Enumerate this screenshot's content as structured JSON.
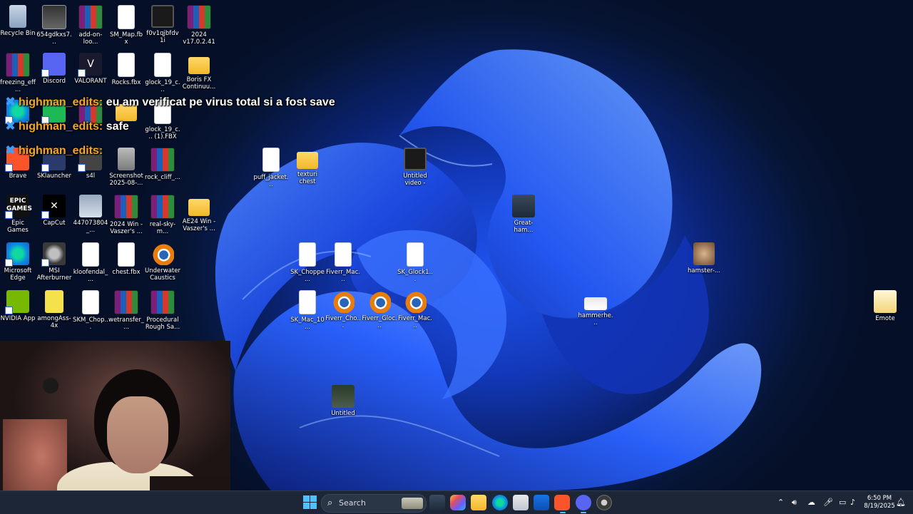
{
  "desktop": {
    "icons": [
      {
        "id": "recycle-bin",
        "label": "Recycle Bin"
      },
      {
        "id": "file-654gdkxs7",
        "label": "654gdkxs7..."
      },
      {
        "id": "add-on-loo",
        "label": "add-on-loo..."
      },
      {
        "id": "sm-map-fbx",
        "label": "SM_Map.fbx"
      },
      {
        "id": "f0v1qjbfdv1i",
        "label": "f0v1qjbfdv1i"
      },
      {
        "id": "2024-v17",
        "label": "2024 v17.0.2.416"
      },
      {
        "id": "freezing-eff",
        "label": "freezing_eff..."
      },
      {
        "id": "discord",
        "label": "Discord"
      },
      {
        "id": "valorant",
        "label": "VALORANT"
      },
      {
        "id": "rocks-fbx",
        "label": "Rocks.fbx"
      },
      {
        "id": "glock-19-c",
        "label": "glock_19_c..."
      },
      {
        "id": "boris-fx",
        "label": "Boris FX Continuu..."
      },
      {
        "id": "glock-19-c-1",
        "label": "glock_19_c... (1).FBX"
      },
      {
        "id": "brave",
        "label": "Brave"
      },
      {
        "id": "sklauncher",
        "label": "SKlauncher"
      },
      {
        "id": "s4l",
        "label": "s4l"
      },
      {
        "id": "screenshot-2025",
        "label": "Screenshot 2025-08-..."
      },
      {
        "id": "rock-cliff",
        "label": "rock_cliff_..."
      },
      {
        "id": "puff-jacket",
        "label": "puff_jacket..."
      },
      {
        "id": "texturi-chest",
        "label": "texturi chest"
      },
      {
        "id": "untitled-video",
        "label": "Untitled video - Ma..."
      },
      {
        "id": "epic-games",
        "label": "Epic Games Launcher"
      },
      {
        "id": "capcut",
        "label": "CapCut"
      },
      {
        "id": "447073804",
        "label": "447073804_..."
      },
      {
        "id": "2024-win-vaszer",
        "label": "2024 Win - Vaszer's ..."
      },
      {
        "id": "real-sky-m",
        "label": "real-sky-m..."
      },
      {
        "id": "ae24-win-vaszer",
        "label": "AE24 Win - Vaszer's ..."
      },
      {
        "id": "great-ham",
        "label": "Great-ham..."
      },
      {
        "id": "microsoft-edge",
        "label": "Microsoft Edge"
      },
      {
        "id": "msi-afterburner",
        "label": "MSI Afterburner"
      },
      {
        "id": "kloofendal",
        "label": "kloofendal_..."
      },
      {
        "id": "chest-fbx",
        "label": "chest.fbx"
      },
      {
        "id": "underwater-caustics",
        "label": "Underwater Caustics Li..."
      },
      {
        "id": "sk-choppe",
        "label": "SK_Choppe..."
      },
      {
        "id": "fiverr-mac-1",
        "label": "Fiverr_Mac..."
      },
      {
        "id": "sk-glock1",
        "label": "SK_Glock1..."
      },
      {
        "id": "hamster",
        "label": "hamster-..."
      },
      {
        "id": "nvidia-app",
        "label": "NVIDIA App"
      },
      {
        "id": "amongass",
        "label": "amongAss-4x"
      },
      {
        "id": "skm-chop",
        "label": "SKM_Chop..."
      },
      {
        "id": "wetransfer",
        "label": "wetransfer_..."
      },
      {
        "id": "procedural-rough",
        "label": "Procedural Rough Sa..."
      },
      {
        "id": "sk-mac-10",
        "label": "SK_Mac_10..."
      },
      {
        "id": "fiverr-cho",
        "label": "Fiverr_Cho..."
      },
      {
        "id": "fiverr-gloc",
        "label": "Fiverr_Gloc..."
      },
      {
        "id": "fiverr-mac-2",
        "label": "Fiverr_Mac..."
      },
      {
        "id": "hammerhe",
        "label": "hammerhe..."
      },
      {
        "id": "emote",
        "label": "Emote"
      },
      {
        "id": "untitled",
        "label": "Untitled"
      }
    ]
  },
  "chat": [
    {
      "user": "highman_edits:",
      "message": "eu am verificat pe virus total si a fost save"
    },
    {
      "user": "highman_edits:",
      "message": "safe"
    },
    {
      "user": "highman_edits:",
      "message": ""
    }
  ],
  "taskbar": {
    "search_label": "Search",
    "clock_time": "6:50 PM",
    "clock_date": "8/19/2025",
    "accent": "#4cc2ff"
  }
}
